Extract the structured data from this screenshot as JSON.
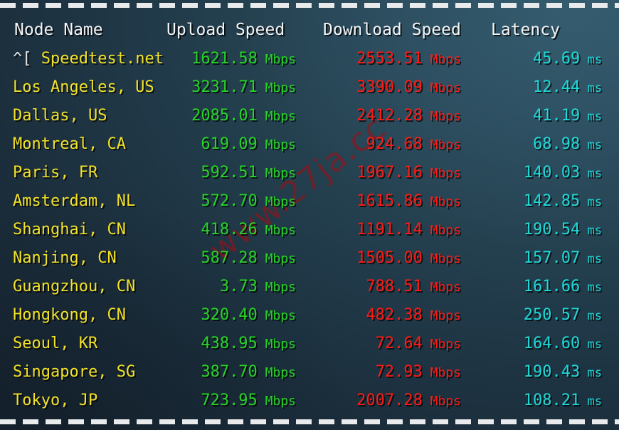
{
  "window": {
    "title": "Speedtest Results Table",
    "background_top_right": "#2f5365",
    "background_bottom_left": "#192834",
    "border_style": "dashed",
    "border_color": "#e8eaec"
  },
  "watermark": {
    "text": "www.27ja.cc",
    "color": "#961218"
  },
  "colors": {
    "header": "#f2f4f6",
    "node": "#f2e229",
    "upload": "#27d327",
    "download": "#ff1a14",
    "latency": "#1fd8d8",
    "escape": "#e6e9ec"
  },
  "table": {
    "headers": {
      "node": "Node Name",
      "upload": "Upload Speed",
      "download": "Download Speed",
      "latency": "Latency"
    },
    "units": {
      "speed": "Mbps",
      "latency": "ms"
    },
    "rows": [
      {
        "escape": "^[",
        "node": "Speedtest.net",
        "upload": "1621.58",
        "upload_unit": "Mbps",
        "download": "2553.51",
        "download_unit": "Mbps",
        "latency": "45.69",
        "latency_unit": "ms"
      },
      {
        "escape": "",
        "node": "Los Angeles, US",
        "upload": "3231.71",
        "upload_unit": "Mbps",
        "download": "3390.09",
        "download_unit": "Mbps",
        "latency": "12.44",
        "latency_unit": "ms"
      },
      {
        "escape": "",
        "node": "Dallas, US",
        "upload": "2085.01",
        "upload_unit": "Mbps",
        "download": "2412.28",
        "download_unit": "Mbps",
        "latency": "41.19",
        "latency_unit": "ms"
      },
      {
        "escape": "",
        "node": "Montreal, CA",
        "upload": "619.09",
        "upload_unit": "Mbps",
        "download": "924.68",
        "download_unit": "Mbps",
        "latency": "68.98",
        "latency_unit": "ms"
      },
      {
        "escape": "",
        "node": "Paris, FR",
        "upload": "592.51",
        "upload_unit": "Mbps",
        "download": "1967.16",
        "download_unit": "Mbps",
        "latency": "140.03",
        "latency_unit": "ms"
      },
      {
        "escape": "",
        "node": "Amsterdam, NL",
        "upload": "572.70",
        "upload_unit": "Mbps",
        "download": "1615.86",
        "download_unit": "Mbps",
        "latency": "142.85",
        "latency_unit": "ms"
      },
      {
        "escape": "",
        "node": "Shanghai, CN",
        "upload": "418.26",
        "upload_unit": "Mbps",
        "download": "1191.14",
        "download_unit": "Mbps",
        "latency": "190.54",
        "latency_unit": "ms"
      },
      {
        "escape": "",
        "node": "Nanjing, CN",
        "upload": "587.28",
        "upload_unit": "Mbps",
        "download": "1505.00",
        "download_unit": "Mbps",
        "latency": "157.07",
        "latency_unit": "ms"
      },
      {
        "escape": "",
        "node": "Guangzhou, CN",
        "upload": "3.73",
        "upload_unit": "Mbps",
        "download": "788.51",
        "download_unit": "Mbps",
        "latency": "161.66",
        "latency_unit": "ms"
      },
      {
        "escape": "",
        "node": "Hongkong, CN",
        "upload": "320.40",
        "upload_unit": "Mbps",
        "download": "482.38",
        "download_unit": "Mbps",
        "latency": "250.57",
        "latency_unit": "ms"
      },
      {
        "escape": "",
        "node": "Seoul, KR",
        "upload": "438.95",
        "upload_unit": "Mbps",
        "download": "72.64",
        "download_unit": "Mbps",
        "latency": "164.60",
        "latency_unit": "ms"
      },
      {
        "escape": "",
        "node": "Singapore, SG",
        "upload": "387.70",
        "upload_unit": "Mbps",
        "download": "72.93",
        "download_unit": "Mbps",
        "latency": "190.43",
        "latency_unit": "ms"
      },
      {
        "escape": "",
        "node": "Tokyo, JP",
        "upload": "723.95",
        "upload_unit": "Mbps",
        "download": "2007.28",
        "download_unit": "Mbps",
        "latency": "108.21",
        "latency_unit": "ms"
      }
    ]
  }
}
